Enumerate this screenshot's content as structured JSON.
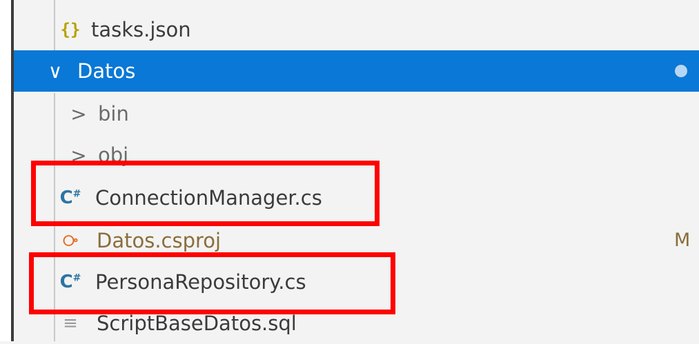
{
  "explorer": {
    "items": [
      {
        "name": "tasks.json",
        "icon": "json-braces-icon"
      },
      {
        "name": "Datos",
        "icon": "chevron-down-icon",
        "selected": true,
        "has_dot": true
      },
      {
        "name": "bin",
        "icon": "chevron-right-icon"
      },
      {
        "name": "obj",
        "icon": "chevron-right-icon"
      },
      {
        "name": "ConnectionManager.cs",
        "icon": "csharp-file-icon"
      },
      {
        "name": "Datos.csproj",
        "icon": "rss-file-icon",
        "status": "M"
      },
      {
        "name": "PersonaRepository.cs",
        "icon": "csharp-file-icon"
      },
      {
        "name": "ScriptBaseDatos.sql",
        "icon": "sql-file-icon"
      }
    ],
    "icons": {
      "json_glyph": "{}",
      "csharp_glyph": "C",
      "csharp_sup": "#",
      "rss_glyph": "⧂",
      "sql_glyph": "≡",
      "chevron_down": "∨",
      "chevron_right": ">"
    }
  },
  "colors": {
    "selection": "#0a78d6",
    "highlight_box": "#ff0000",
    "modified_text": "#8a6d3b"
  }
}
